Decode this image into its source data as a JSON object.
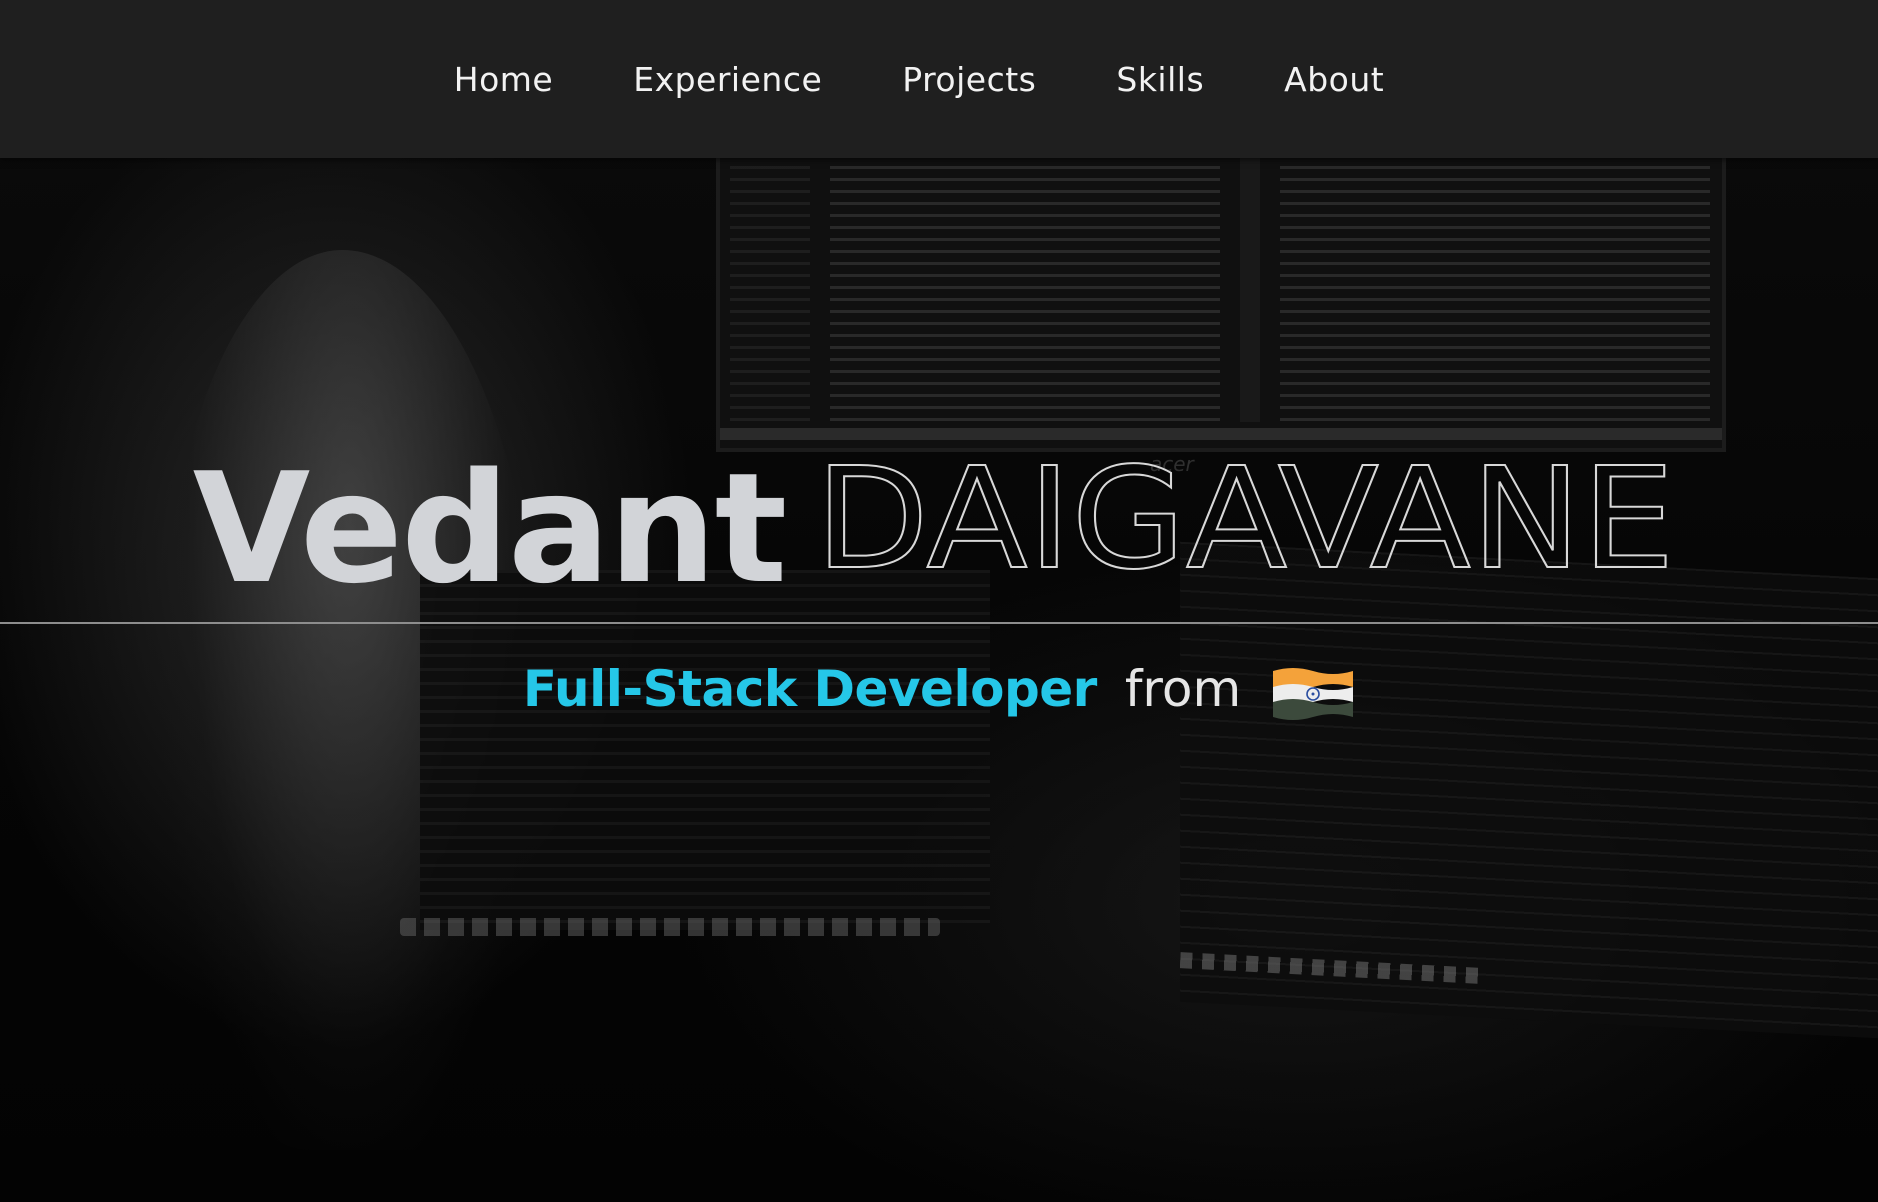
{
  "nav": {
    "items": [
      {
        "label": "Home"
      },
      {
        "label": "Experience"
      },
      {
        "label": "Projects"
      },
      {
        "label": "Skills"
      },
      {
        "label": "About"
      }
    ]
  },
  "hero": {
    "first_name": "Vedant",
    "last_name": "DAIGAVANE",
    "role": "Full-Stack Developer",
    "from_text": "from",
    "flag_icon": "india-flag-icon"
  },
  "background": {
    "monitor_brand": "acer"
  },
  "colors": {
    "accent": "#25c7e8",
    "nav_bg": "#1f1f1f",
    "name_fill": "#d2d4d8",
    "flag_saffron": "#f4a23a",
    "flag_white": "#ededed",
    "flag_green": "#3c4a3c",
    "flag_chakra": "#2b4ea0"
  }
}
